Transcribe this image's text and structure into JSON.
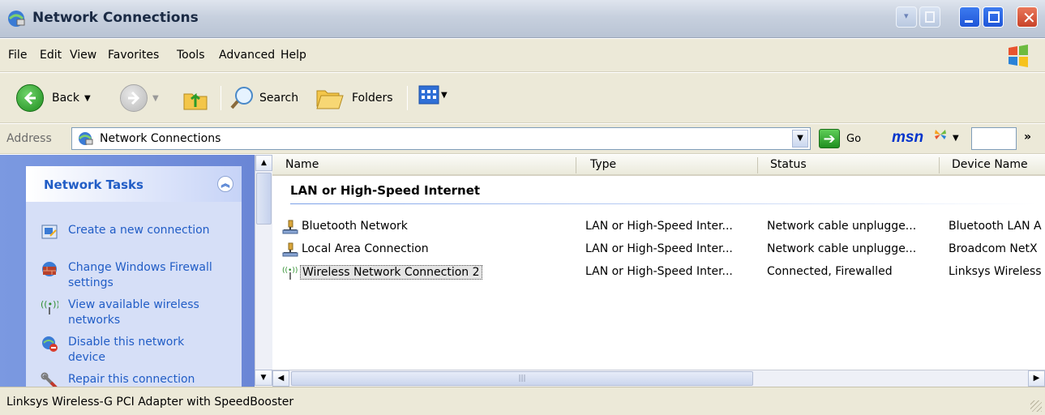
{
  "window": {
    "title": "Network Connections"
  },
  "menu": [
    "File",
    "Edit",
    "View",
    "Favorites",
    "Tools",
    "Advanced",
    "Help"
  ],
  "toolbar": {
    "back_label": "Back",
    "search_label": "Search",
    "folders_label": "Folders"
  },
  "address": {
    "label": "Address",
    "value": "Network Connections",
    "go_label": "Go",
    "msn_label": "msn",
    "more_label": "»"
  },
  "tasks": {
    "title": "Network Tasks",
    "items": [
      {
        "label": "Create a new connection",
        "icon": "new-connection-icon"
      },
      {
        "label": "Change Windows Firewall settings",
        "icon": "firewall-icon"
      },
      {
        "label": "View available wireless networks",
        "icon": "wireless-icon"
      },
      {
        "label": "Disable this network device",
        "icon": "disable-device-icon"
      },
      {
        "label": "Repair this connection",
        "icon": "repair-icon"
      }
    ]
  },
  "list": {
    "columns": [
      "Name",
      "Type",
      "Status",
      "Device Name"
    ],
    "group": "LAN or High-Speed Internet",
    "rows": [
      {
        "name": "Bluetooth Network",
        "type": "LAN or High-Speed Inter...",
        "status": "Network cable unplugge...",
        "device": "Bluetooth LAN A",
        "icon": "lan-icon"
      },
      {
        "name": "Local Area Connection",
        "type": "LAN or High-Speed Inter...",
        "status": "Network cable unplugge...",
        "device": "Broadcom NetX",
        "icon": "lan-icon"
      },
      {
        "name": "Wireless Network Connection 2",
        "type": "LAN or High-Speed Inter...",
        "status": "Connected, Firewalled",
        "device": "Linksys Wireless",
        "icon": "wireless-icon",
        "selected": true
      }
    ]
  },
  "statusbar": {
    "text": "Linksys Wireless-G PCI Adapter with SpeedBooster"
  },
  "colors": {
    "title_text": "#1a2a44",
    "task_link": "#215dc6",
    "xp_blue": "#6a86d6"
  }
}
